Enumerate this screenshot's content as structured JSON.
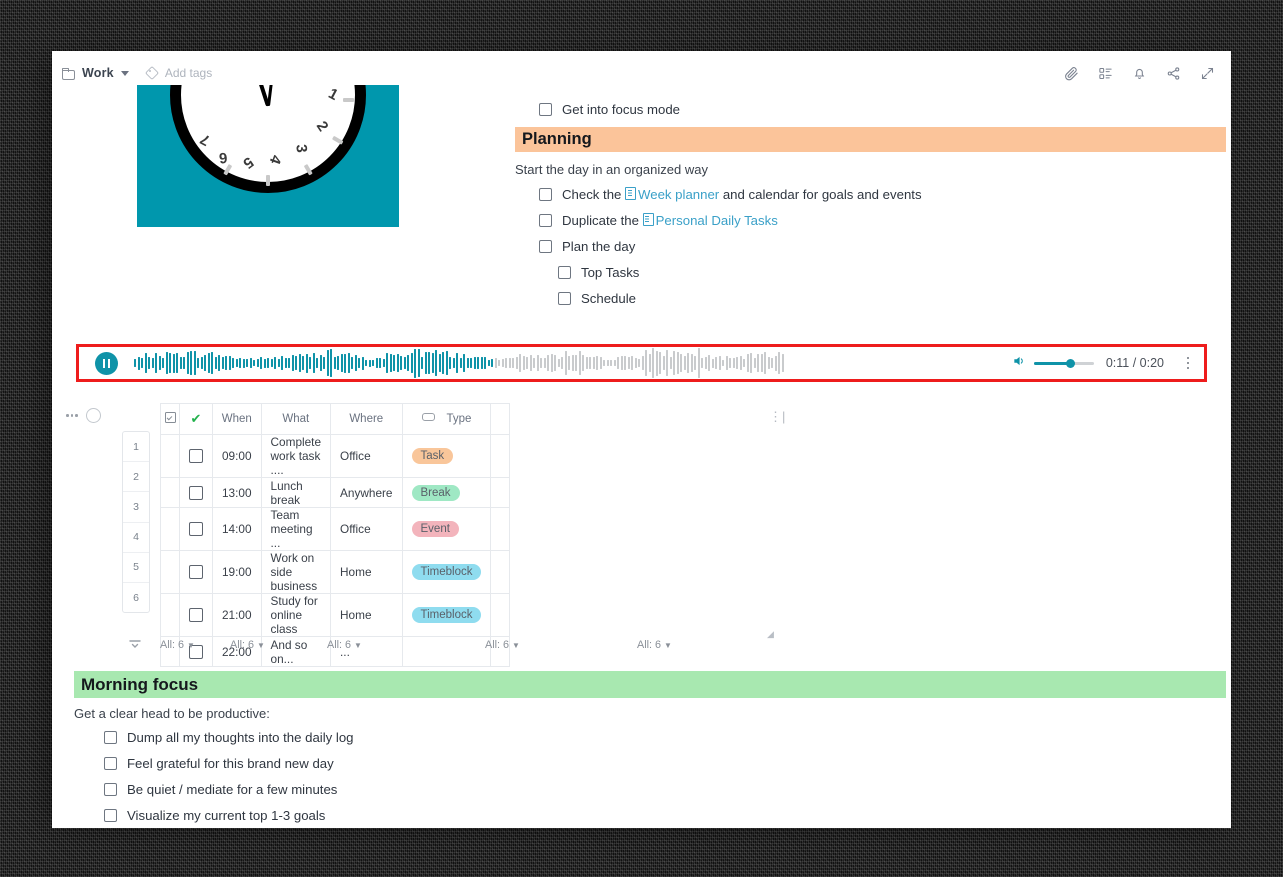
{
  "header": {
    "folder_label": "Work",
    "add_tags_label": "Add tags",
    "icons": [
      "paperclip-icon",
      "list-view-icon",
      "bell-icon",
      "share-icon",
      "expand-icon"
    ]
  },
  "clock": {
    "numbers": [
      "1",
      "2",
      "3",
      "4",
      "5",
      "6",
      "7"
    ],
    "background_color": "#0097ad"
  },
  "checklist_top": [
    {
      "label": "Get into focus mode"
    }
  ],
  "planning": {
    "banner_title": "Planning",
    "banner_color": "#fbc49a",
    "subtitle": "Start the day in an organized way",
    "items": [
      {
        "prefix": "Check the ",
        "link": "Week planner",
        "suffix": " and calendar for goals and events",
        "indent": 0
      },
      {
        "prefix": "Duplicate the ",
        "link": "Personal Daily Tasks",
        "suffix": "",
        "indent": 0
      },
      {
        "prefix": "Plan the day",
        "link": "",
        "suffix": "",
        "indent": 0
      },
      {
        "prefix": "Top Tasks",
        "link": "",
        "suffix": "",
        "indent": 1
      },
      {
        "prefix": "Schedule",
        "link": "",
        "suffix": "",
        "indent": 1
      }
    ]
  },
  "player": {
    "state": "playing",
    "play_button": "pause-icon",
    "time_display": "0:11 / 0:20",
    "elapsed": "0:11",
    "duration": "0:20",
    "volume_icon": "speaker-icon",
    "menu_icon": "kebab-menu-icon",
    "accent_color": "#0f93a8",
    "highlight_border_color": "#ee1c1c",
    "progress_percent": 55
  },
  "table": {
    "columns": [
      "",
      "When",
      "What",
      "Where",
      "Type"
    ],
    "header_check_icon": "checkbox-icon",
    "header_done_icon": "green-check-icon",
    "type_column_icon": "capsule-icon",
    "rows": [
      {
        "num": "1",
        "when": "09:00",
        "what": "Complete work task ....",
        "where": "Office",
        "type": "Task",
        "type_color": "#f9c69a"
      },
      {
        "num": "2",
        "when": "13:00",
        "what": "Lunch break",
        "where": "Anywhere",
        "type": "Break",
        "type_color": "#9fe8c4"
      },
      {
        "num": "3",
        "when": "14:00",
        "what": "Team meeting ...",
        "where": "Office",
        "type": "Event",
        "type_color": "#f3b4bc"
      },
      {
        "num": "4",
        "when": "19:00",
        "what": "Work on side business",
        "where": "Home",
        "type": "Timeblock",
        "type_color": "#8fdcef"
      },
      {
        "num": "5",
        "when": "21:00",
        "what": "Study for online class",
        "where": "Home",
        "type": "Timeblock",
        "type_color": "#8fdcef"
      },
      {
        "num": "6",
        "when": "22:00",
        "what": "And so on...",
        "where": "...",
        "type": "",
        "type_color": ""
      }
    ],
    "footer_summaries": [
      "All: 6",
      "All: 6",
      "All: 6",
      "All: 6",
      "All: 6"
    ]
  },
  "morning_focus": {
    "banner_title": "Morning focus",
    "banner_color": "#a8e8b0",
    "subtitle": "Get a clear head to be productive:",
    "items": [
      {
        "label": "Dump all my thoughts into the daily log"
      },
      {
        "label": "Feel grateful for this brand new day"
      },
      {
        "label": "Be quiet / mediate for a few minutes"
      },
      {
        "label": "Visualize my current top 1-3 goals"
      }
    ]
  }
}
